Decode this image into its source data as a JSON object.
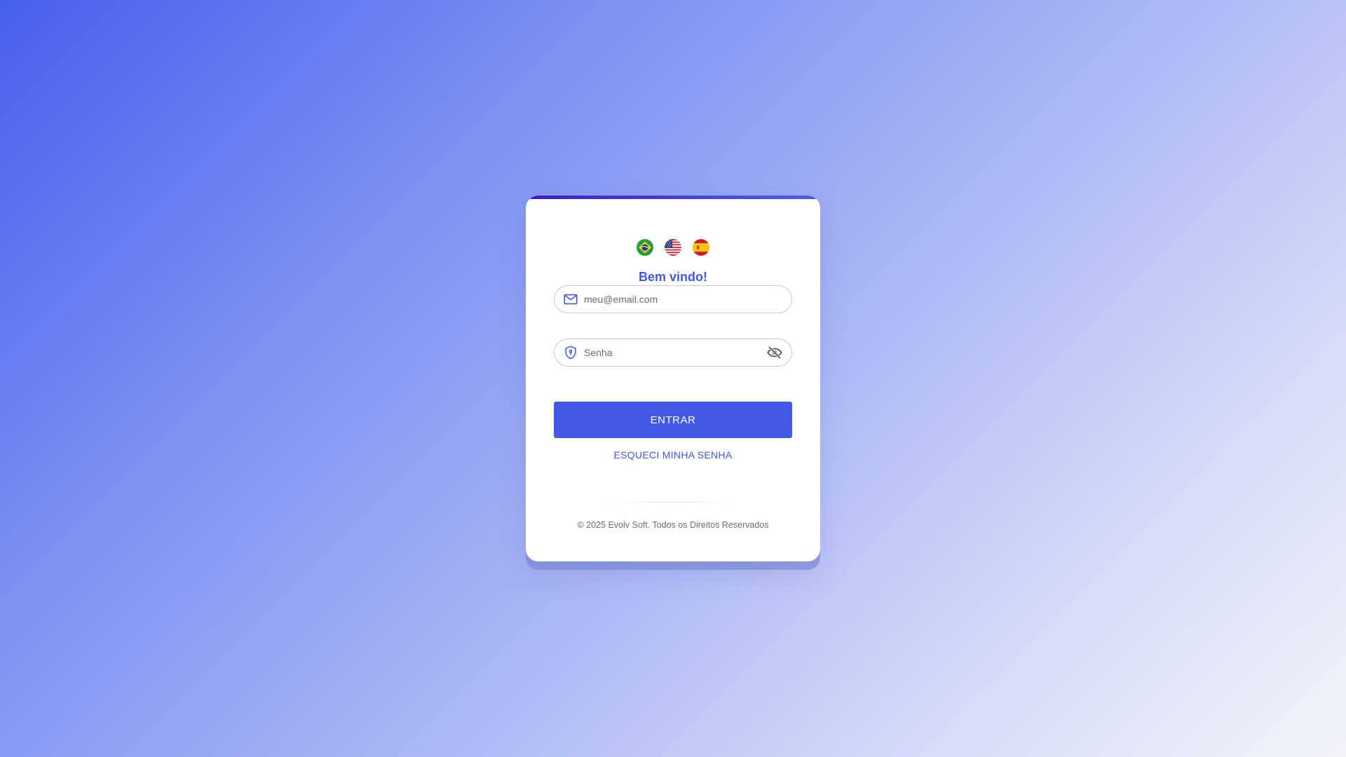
{
  "languages": [
    {
      "code": "pt-BR",
      "icon": "brazil-flag-icon"
    },
    {
      "code": "en-US",
      "icon": "usa-flag-icon"
    },
    {
      "code": "es",
      "icon": "spain-flag-icon"
    }
  ],
  "login": {
    "welcome": "Bem vindo!",
    "email_placeholder": "meu@email.com",
    "email_value": "",
    "email_icon": "mail-icon",
    "password_placeholder": "Senha",
    "password_value": "",
    "password_icon": "shield-lock-icon",
    "visibility_icon": "eye-off-icon",
    "submit_label": "ENTRAR",
    "forgot_label": "ESQUECI MINHA SENHA",
    "footer": "© 2025 Evolv Soft. Todos os Direitos Reservados"
  },
  "colors": {
    "accent": "#4159e6",
    "topbar_start": "#3a1fbf",
    "background_start": "#4560ee",
    "background_end": "#f3f4f9"
  }
}
